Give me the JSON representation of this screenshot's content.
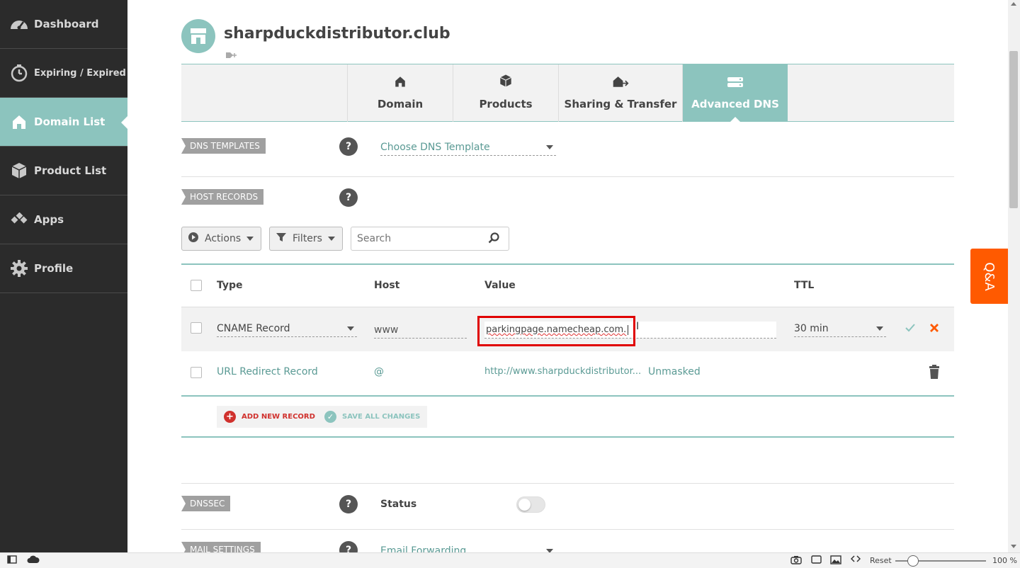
{
  "sidebar": {
    "items": [
      {
        "label": "Dashboard",
        "icon": "speedometer-icon"
      },
      {
        "label": "Expiring / Expired",
        "icon": "stopwatch-icon"
      },
      {
        "label": "Domain List",
        "icon": "home-icon",
        "active": true
      },
      {
        "label": "Product List",
        "icon": "box-icon"
      },
      {
        "label": "Apps",
        "icon": "apps-icon"
      },
      {
        "label": "Profile",
        "icon": "gear-icon"
      }
    ]
  },
  "header": {
    "domain": "sharpduckdistributor.club",
    "icon": "store-icon"
  },
  "tabs": [
    {
      "label": "Domain",
      "icon": "home-icon"
    },
    {
      "label": "Products",
      "icon": "box-icon"
    },
    {
      "label": "Sharing & Transfer",
      "icon": "home-share-icon"
    },
    {
      "label": "Advanced DNS",
      "icon": "server-icon",
      "active": true
    }
  ],
  "dns_templates": {
    "label": "DNS TEMPLATES",
    "help": "?",
    "select_value": "Choose DNS Template"
  },
  "host_records": {
    "label": "HOST RECORDS",
    "help": "?",
    "toolbar": {
      "actions_label": "Actions",
      "filters_label": "Filters",
      "search_placeholder": "Search"
    },
    "columns": {
      "type": "Type",
      "host": "Host",
      "value": "Value",
      "ttl": "TTL"
    },
    "rows": [
      {
        "type": "CNAME Record",
        "host": "www",
        "value": "parkingpage.namecheap.com.",
        "ttl": "30 min",
        "editing": true
      },
      {
        "type": "URL Redirect Record",
        "host": "@",
        "value": "http://www.sharpduckdistributor...",
        "extra": "Unmasked"
      }
    ],
    "add_label": "ADD NEW RECORD",
    "save_label": "SAVE ALL CHANGES"
  },
  "dnssec": {
    "label": "DNSSEC",
    "help": "?",
    "status_label": "Status",
    "enabled": false
  },
  "mail_settings": {
    "label": "MAIL SETTINGS",
    "help": "?",
    "select_value": "Email Forwarding"
  },
  "qa_label": "Q&A",
  "statusbar": {
    "reset_label": "Reset",
    "zoom": "100 %"
  },
  "colors": {
    "accent": "#8cc4be",
    "sidebar_bg": "#2b2b2b",
    "qa_orange": "#ff5a00",
    "highlight": "#e00000",
    "cancel": "#ff5a00"
  }
}
